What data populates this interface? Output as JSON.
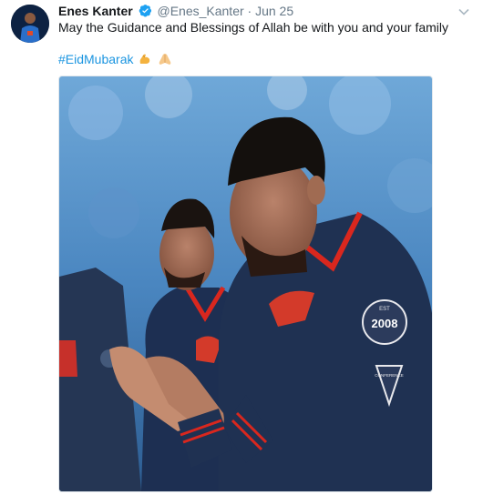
{
  "tweet": {
    "display_name": "Enes Kanter",
    "handle": "@Enes_Kanter",
    "separator": "·",
    "date": "Jun 25",
    "text": "May the Guidance and Blessings of Allah be with you and your family",
    "hashtag": "#EidMubarak",
    "emojis": [
      "muscle-emoji",
      "folded-hands-emoji"
    ]
  },
  "photo": {
    "jersey_patch": "2008",
    "patch_small": "EST",
    "chevron_text": "CONFERENCE"
  },
  "colors": {
    "link": "#1b95e0",
    "verified": "#1da1f2",
    "jersey": "#1f3152",
    "jersey_red": "#d9271e"
  }
}
